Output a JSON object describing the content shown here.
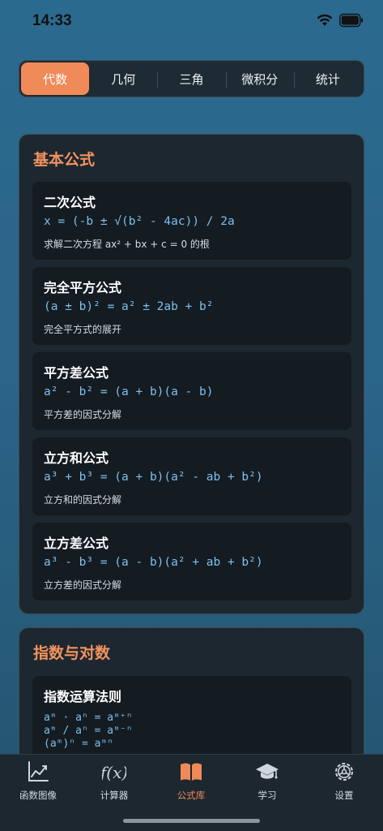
{
  "status": {
    "time": "14:33"
  },
  "segments": [
    {
      "label": "代数",
      "active": true
    },
    {
      "label": "几何",
      "active": false
    },
    {
      "label": "三角",
      "active": false
    },
    {
      "label": "微积分",
      "active": false
    },
    {
      "label": "统计",
      "active": false
    }
  ],
  "sections": {
    "basic": {
      "title": "基本公式",
      "formulas": [
        {
          "name": "二次公式",
          "expr": "x = (-b ± √(b² - 4ac)) / 2a",
          "desc": "求解二次方程 ax² + bx + c = 0 的根"
        },
        {
          "name": "完全平方公式",
          "expr": "(a ± b)² = a² ± 2ab + b²",
          "desc": "完全平方式的展开"
        },
        {
          "name": "平方差公式",
          "expr": "a² - b² = (a + b)(a - b)",
          "desc": "平方差的因式分解"
        },
        {
          "name": "立方和公式",
          "expr": "a³ + b³ = (a + b)(a² - ab + b²)",
          "desc": "立方和的因式分解"
        },
        {
          "name": "立方差公式",
          "expr": "a³ - b³ = (a - b)(a² + ab + b²)",
          "desc": "立方差的因式分解"
        }
      ]
    },
    "exp": {
      "title": "指数与对数",
      "formulas": [
        {
          "name": "指数运算法则",
          "lines": [
            "aᵐ · aⁿ = aᵐ⁺ⁿ",
            "aᵐ / aⁿ = aᵐ⁻ⁿ",
            "(aᵐ)ⁿ = aᵐⁿ"
          ]
        }
      ]
    }
  },
  "tabs": [
    {
      "label": "函数图像",
      "icon": "chart-line-icon",
      "active": false
    },
    {
      "label": "计算器",
      "icon": "function-icon",
      "active": false
    },
    {
      "label": "公式库",
      "icon": "book-icon",
      "active": true
    },
    {
      "label": "学习",
      "icon": "graduation-cap-icon",
      "active": false
    },
    {
      "label": "设置",
      "icon": "gear-icon",
      "active": false
    }
  ],
  "colors": {
    "accent": "#f08a58",
    "formula": "#7cc0ee",
    "title": "#f3935f"
  }
}
